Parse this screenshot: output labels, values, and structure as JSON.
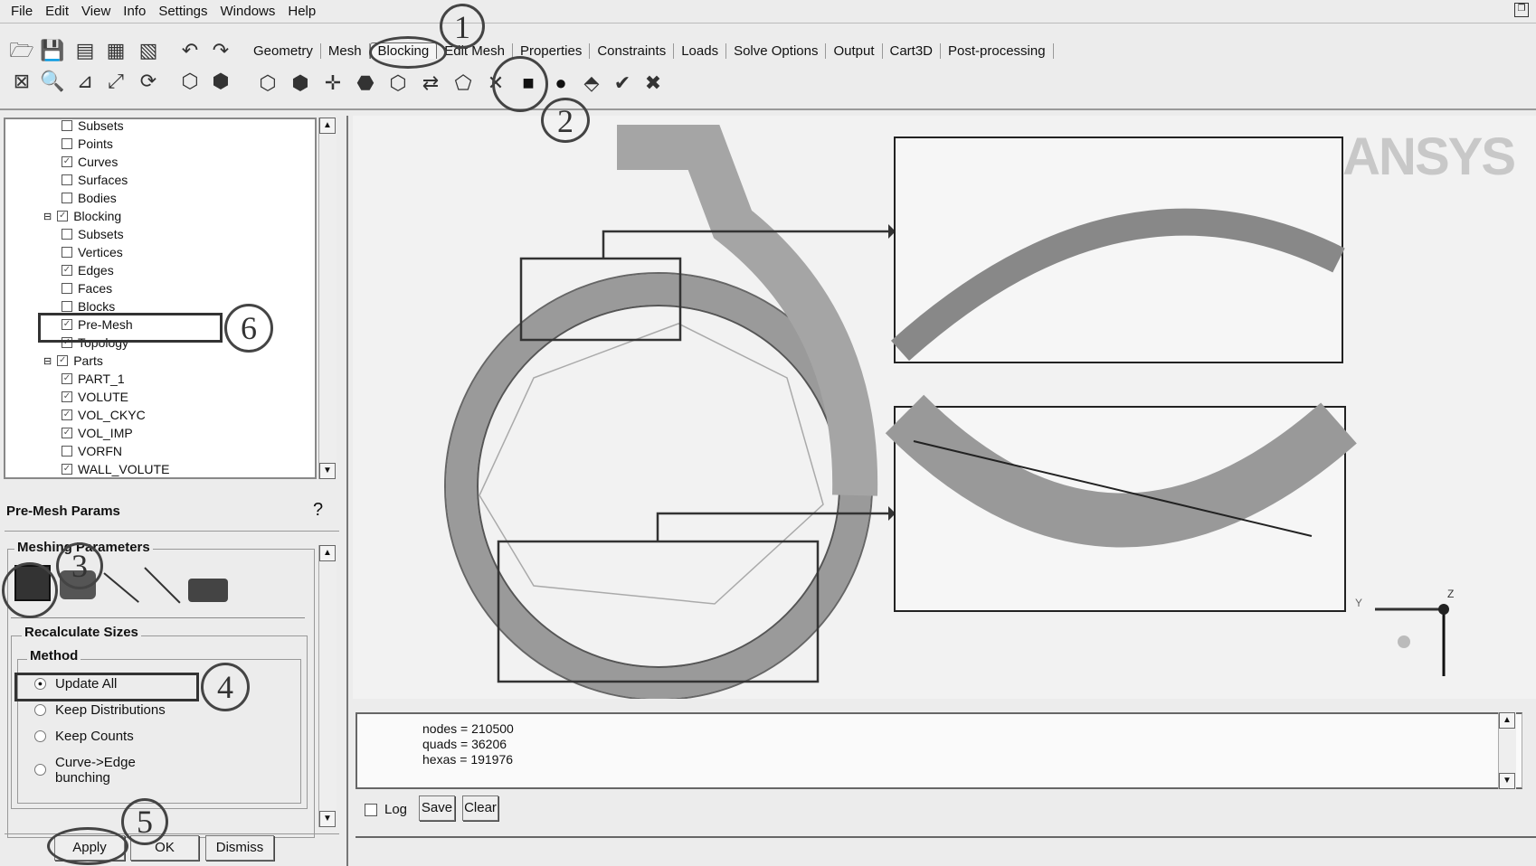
{
  "menu": [
    "File",
    "Edit",
    "View",
    "Info",
    "Settings",
    "Windows",
    "Help"
  ],
  "tabs": [
    "Geometry",
    "Mesh",
    "Blocking",
    "Edit Mesh",
    "Properties",
    "Constraints",
    "Loads",
    "Solve Options",
    "Output",
    "Cart3D",
    "Post-processing"
  ],
  "active_tab": "Blocking",
  "tree": [
    {
      "label": "Subsets",
      "checked": false,
      "level": 2
    },
    {
      "label": "Points",
      "checked": false,
      "level": 2
    },
    {
      "label": "Curves",
      "checked": true,
      "level": 2
    },
    {
      "label": "Surfaces",
      "checked": false,
      "level": 2
    },
    {
      "label": "Bodies",
      "checked": false,
      "level": 2
    },
    {
      "label": "Blocking",
      "checked": true,
      "level": 1
    },
    {
      "label": "Subsets",
      "checked": false,
      "level": 2
    },
    {
      "label": "Vertices",
      "checked": false,
      "level": 2
    },
    {
      "label": "Edges",
      "checked": true,
      "level": 2
    },
    {
      "label": "Faces",
      "checked": false,
      "level": 2
    },
    {
      "label": "Blocks",
      "checked": false,
      "level": 2
    },
    {
      "label": "Pre-Mesh",
      "checked": true,
      "level": 2
    },
    {
      "label": "Topology",
      "checked": true,
      "level": 2
    },
    {
      "label": "Parts",
      "checked": true,
      "level": 1
    },
    {
      "label": "PART_1",
      "checked": true,
      "level": 2
    },
    {
      "label": "VOLUTE",
      "checked": true,
      "level": 2
    },
    {
      "label": "VOL_CKYC",
      "checked": true,
      "level": 2
    },
    {
      "label": "VOL_IMP",
      "checked": true,
      "level": 2
    },
    {
      "label": "VORFN",
      "checked": false,
      "level": 2
    },
    {
      "label": "WALL_VOLUTE",
      "checked": true,
      "level": 2
    }
  ],
  "params": {
    "title": "Pre-Mesh Params",
    "group": "Meshing Parameters",
    "recalc": "Recalculate Sizes",
    "method": "Method",
    "options": [
      "Update All",
      "Keep Distributions",
      "Keep Counts",
      "Curve->Edge\nbunching"
    ],
    "selected": "Update All",
    "apply": "Apply",
    "ok": "OK",
    "dismiss": "Dismiss"
  },
  "annotations": [
    "1",
    "2",
    "3",
    "4",
    "5",
    "6"
  ],
  "logo": "ANSYS",
  "messages": [
    "nodes = 210500",
    "quads = 36206",
    "hexas = 191976"
  ],
  "log_label": "Log",
  "save": "Save",
  "clear": "Clear",
  "axis": {
    "y": "Y",
    "z": "Z"
  }
}
